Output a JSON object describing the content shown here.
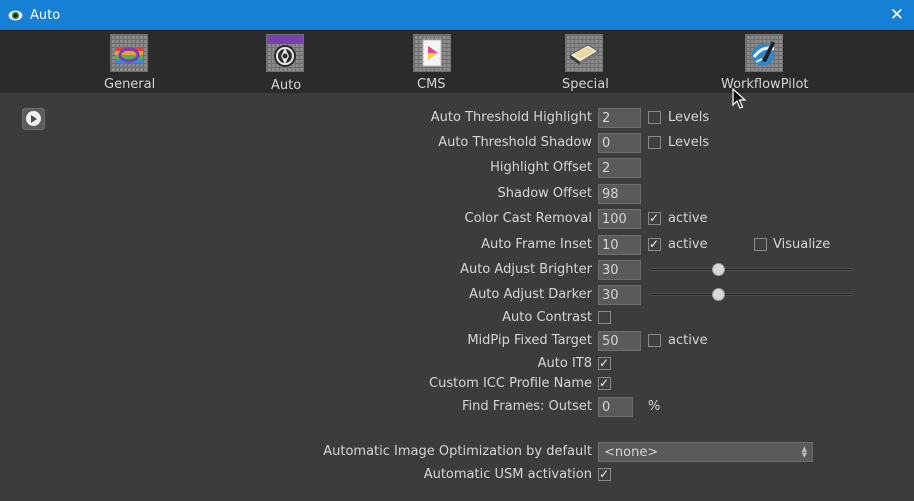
{
  "window": {
    "title": "Auto",
    "close_glyph": "✕"
  },
  "tabs": [
    {
      "label": "General",
      "icon": "general-palette-icon"
    },
    {
      "label": "Auto",
      "icon": "auto-aperture-icon"
    },
    {
      "label": "CMS",
      "icon": "cms-color-icon"
    },
    {
      "label": "Special",
      "icon": "special-film-icon"
    },
    {
      "label": "WorkflowPilot",
      "icon": "workflowpilot-icon"
    }
  ],
  "active_tab": "Auto",
  "settings": {
    "auto_threshold_highlight": {
      "label": "Auto Threshold Highlight",
      "value": "2",
      "check_label": "Levels",
      "checked": false
    },
    "auto_threshold_shadow": {
      "label": "Auto Threshold Shadow",
      "value": "0",
      "check_label": "Levels",
      "checked": false
    },
    "highlight_offset": {
      "label": "Highlight Offset",
      "value": "2"
    },
    "shadow_offset": {
      "label": "Shadow Offset",
      "value": "98"
    },
    "color_cast_removal": {
      "label": "Color Cast Removal",
      "value": "100",
      "check_label": "active",
      "checked": true
    },
    "auto_frame_inset": {
      "label": "Auto Frame Inset",
      "value": "10",
      "check_label": "active",
      "checked": true,
      "visualize_label": "Visualize",
      "visualize_checked": false
    },
    "auto_adjust_brighter": {
      "label": "Auto Adjust Brighter",
      "value": "30",
      "slider_level": 0.31
    },
    "auto_adjust_darker": {
      "label": "Auto Adjust Darker",
      "value": "30",
      "slider_level": 0.31
    },
    "auto_contrast": {
      "label": "Auto Contrast",
      "checked": false
    },
    "midpip_fixed_target": {
      "label": "MidPip Fixed Target",
      "value": "50",
      "check_label": "active",
      "checked": false
    },
    "auto_it8": {
      "label": "Auto IT8",
      "checked": true
    },
    "custom_icc_profile_name": {
      "label": "Custom ICC Profile Name",
      "checked": true
    },
    "find_frames_outset": {
      "label": "Find Frames: Outset",
      "value": "0",
      "unit": "%"
    },
    "automatic_image_optimization": {
      "label": "Automatic Image Optimization by default",
      "selected": "<none>"
    },
    "automatic_usm_activation": {
      "label": "Automatic USM activation",
      "checked": true
    }
  },
  "colors": {
    "titlebar": "#1680d4",
    "background": "#3c3c3c",
    "toolbar": "#2b2b2b"
  }
}
